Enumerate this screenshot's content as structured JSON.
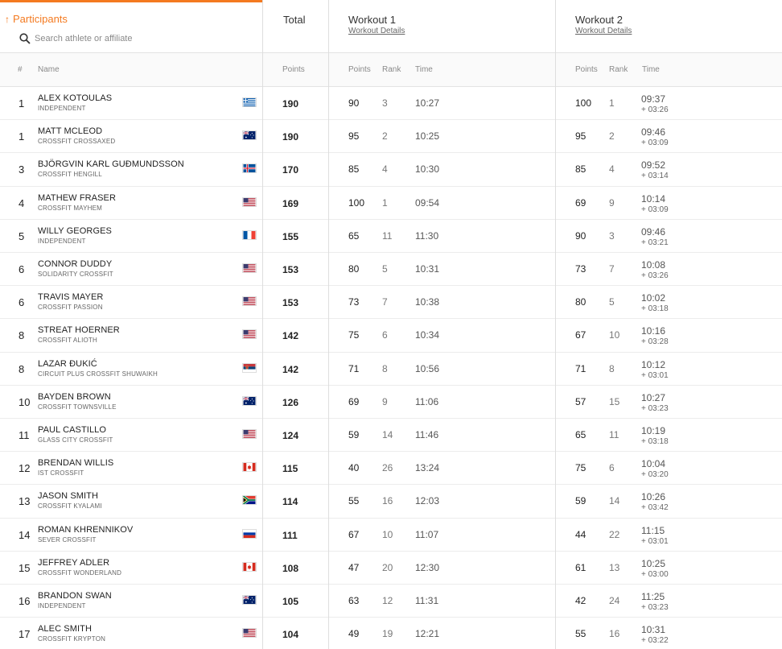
{
  "header": {
    "participants_label": "Participants",
    "search_placeholder": "Search athlete or affiliate",
    "total_label": "Total",
    "workout1_title": "Workout 1",
    "workout1_link": "Workout Details",
    "workout2_title": "Workout 2",
    "workout2_link": "Workout Details",
    "accent_color": "#f47a20"
  },
  "columns": {
    "rank": "#",
    "name": "Name",
    "points": "Points",
    "w_points": "Points",
    "w_rank": "Rank",
    "w_time": "Time"
  },
  "rows": [
    {
      "rank": "1",
      "name": "ALEX KOTOULAS",
      "affiliate": "INDEPENDENT",
      "flag": "greece",
      "total": "190",
      "w1_points": "90",
      "w1_rank": "3",
      "w1_time": "10:27",
      "w2_points": "100",
      "w2_rank": "1",
      "w2_time": "09:37",
      "w2_diff": "+ 03:26"
    },
    {
      "rank": "1",
      "name": "MATT MCLEOD",
      "affiliate": "CROSSFIT CROSSAXED",
      "flag": "australia",
      "total": "190",
      "w1_points": "95",
      "w1_rank": "2",
      "w1_time": "10:25",
      "w2_points": "95",
      "w2_rank": "2",
      "w2_time": "09:46",
      "w2_diff": "+ 03:09"
    },
    {
      "rank": "3",
      "name": "BJÖRGVIN KARL GUÐMUNDSSON",
      "affiliate": "CROSSFIT HENGILL",
      "flag": "iceland",
      "total": "170",
      "w1_points": "85",
      "w1_rank": "4",
      "w1_time": "10:30",
      "w2_points": "85",
      "w2_rank": "4",
      "w2_time": "09:52",
      "w2_diff": "+ 03:14"
    },
    {
      "rank": "4",
      "name": "MATHEW FRASER",
      "affiliate": "CROSSFIT MAYHEM",
      "flag": "usa",
      "total": "169",
      "w1_points": "100",
      "w1_rank": "1",
      "w1_time": "09:54",
      "w2_points": "69",
      "w2_rank": "9",
      "w2_time": "10:14",
      "w2_diff": "+ 03:09"
    },
    {
      "rank": "5",
      "name": "WILLY GEORGES",
      "affiliate": "INDEPENDENT",
      "flag": "france",
      "total": "155",
      "w1_points": "65",
      "w1_rank": "11",
      "w1_time": "11:30",
      "w2_points": "90",
      "w2_rank": "3",
      "w2_time": "09:46",
      "w2_diff": "+ 03:21"
    },
    {
      "rank": "6",
      "name": "CONNOR DUDDY",
      "affiliate": "SOLIDARITY CROSSFIT",
      "flag": "usa",
      "total": "153",
      "w1_points": "80",
      "w1_rank": "5",
      "w1_time": "10:31",
      "w2_points": "73",
      "w2_rank": "7",
      "w2_time": "10:08",
      "w2_diff": "+ 03:26"
    },
    {
      "rank": "6",
      "name": "TRAVIS MAYER",
      "affiliate": "CROSSFIT PASSION",
      "flag": "usa",
      "total": "153",
      "w1_points": "73",
      "w1_rank": "7",
      "w1_time": "10:38",
      "w2_points": "80",
      "w2_rank": "5",
      "w2_time": "10:02",
      "w2_diff": "+ 03:18"
    },
    {
      "rank": "8",
      "name": "STREAT HOERNER",
      "affiliate": "CROSSFIT ALIOTH",
      "flag": "usa",
      "total": "142",
      "w1_points": "75",
      "w1_rank": "6",
      "w1_time": "10:34",
      "w2_points": "67",
      "w2_rank": "10",
      "w2_time": "10:16",
      "w2_diff": "+ 03:28"
    },
    {
      "rank": "8",
      "name": "LAZAR ĐUKIĆ",
      "affiliate": "CIRCUIT PLUS CROSSFIT SHUWAIKH",
      "flag": "serbia",
      "total": "142",
      "w1_points": "71",
      "w1_rank": "8",
      "w1_time": "10:56",
      "w2_points": "71",
      "w2_rank": "8",
      "w2_time": "10:12",
      "w2_diff": "+ 03:01"
    },
    {
      "rank": "10",
      "name": "BAYDEN BROWN",
      "affiliate": "CROSSFIT TOWNSVILLE",
      "flag": "australia",
      "total": "126",
      "w1_points": "69",
      "w1_rank": "9",
      "w1_time": "11:06",
      "w2_points": "57",
      "w2_rank": "15",
      "w2_time": "10:27",
      "w2_diff": "+ 03:23"
    },
    {
      "rank": "11",
      "name": "PAUL CASTILLO",
      "affiliate": "GLASS CITY CROSSFIT",
      "flag": "usa",
      "total": "124",
      "w1_points": "59",
      "w1_rank": "14",
      "w1_time": "11:46",
      "w2_points": "65",
      "w2_rank": "11",
      "w2_time": "10:19",
      "w2_diff": "+ 03:18"
    },
    {
      "rank": "12",
      "name": "BRENDAN WILLIS",
      "affiliate": "IST CROSSFIT",
      "flag": "canada",
      "total": "115",
      "w1_points": "40",
      "w1_rank": "26",
      "w1_time": "13:24",
      "w2_points": "75",
      "w2_rank": "6",
      "w2_time": "10:04",
      "w2_diff": "+ 03:20"
    },
    {
      "rank": "13",
      "name": "JASON SMITH",
      "affiliate": "CROSSFIT KYALAMI",
      "flag": "south-africa",
      "total": "114",
      "w1_points": "55",
      "w1_rank": "16",
      "w1_time": "12:03",
      "w2_points": "59",
      "w2_rank": "14",
      "w2_time": "10:26",
      "w2_diff": "+ 03:42"
    },
    {
      "rank": "14",
      "name": "ROMAN KHRENNIKOV",
      "affiliate": "SEVER CROSSFIT",
      "flag": "russia",
      "total": "111",
      "w1_points": "67",
      "w1_rank": "10",
      "w1_time": "11:07",
      "w2_points": "44",
      "w2_rank": "22",
      "w2_time": "11:15",
      "w2_diff": "+ 03:01"
    },
    {
      "rank": "15",
      "name": "JEFFREY ADLER",
      "affiliate": "CROSSFIT WONDERLAND",
      "flag": "canada",
      "total": "108",
      "w1_points": "47",
      "w1_rank": "20",
      "w1_time": "12:30",
      "w2_points": "61",
      "w2_rank": "13",
      "w2_time": "10:25",
      "w2_diff": "+ 03:00"
    },
    {
      "rank": "16",
      "name": "BRANDON SWAN",
      "affiliate": "INDEPENDENT",
      "flag": "australia",
      "total": "105",
      "w1_points": "63",
      "w1_rank": "12",
      "w1_time": "11:31",
      "w2_points": "42",
      "w2_rank": "24",
      "w2_time": "11:25",
      "w2_diff": "+ 03:23"
    },
    {
      "rank": "17",
      "name": "ALEC SMITH",
      "affiliate": "CROSSFIT KRYPTON",
      "flag": "usa",
      "total": "104",
      "w1_points": "49",
      "w1_rank": "19",
      "w1_time": "12:21",
      "w2_points": "55",
      "w2_rank": "16",
      "w2_time": "10:31",
      "w2_diff": "+ 03:22"
    }
  ]
}
